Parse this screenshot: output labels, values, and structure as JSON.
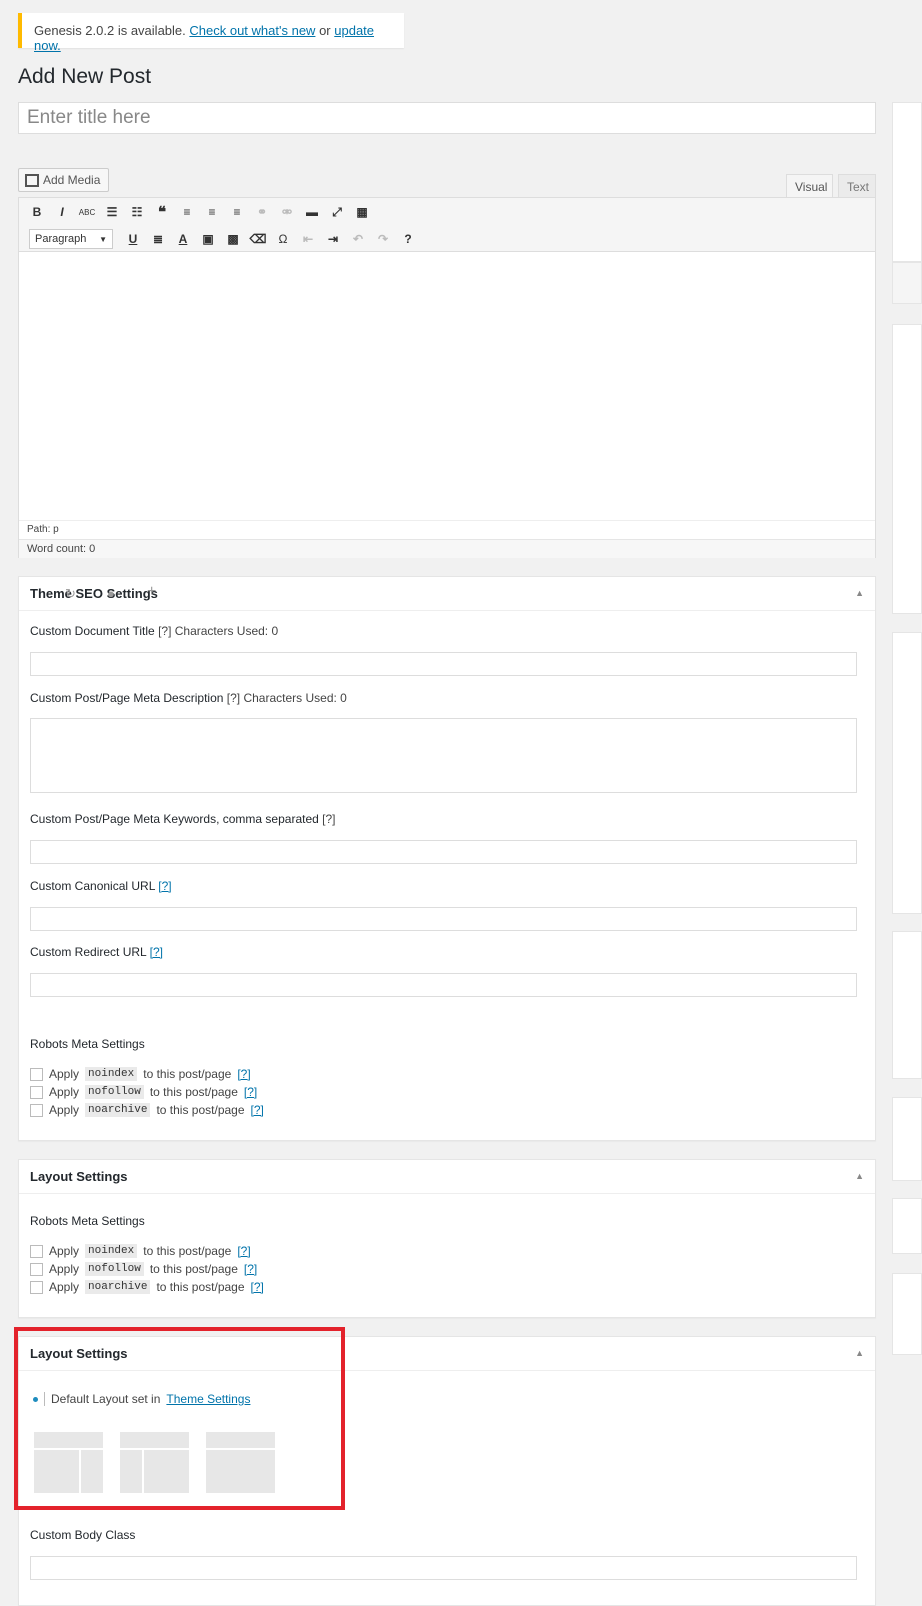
{
  "notice": {
    "text": "Genesis 2.0.2 is available.",
    "link1": "Check out what's new",
    "or": "or",
    "link2": "update now."
  },
  "page_title": "Add New Post",
  "title_input": {
    "placeholder": "Enter title here"
  },
  "editor": {
    "add_media": "Add Media",
    "tabs": {
      "visual": "Visual",
      "text": "Text"
    },
    "format_select": "Paragraph",
    "path": "Path: p",
    "word_count": "Word count: 0"
  },
  "seo_box": {
    "title": "Theme SEO Settings",
    "custom_doc_title": "Custom Document Title",
    "help": "[?]",
    "chars_used": "Characters Used: 0",
    "meta_desc": "Custom Post/Page Meta Description",
    "meta_keywords": "Custom Post/Page Meta Keywords, comma separated",
    "canonical": "Custom Canonical URL",
    "redirect": "Custom Redirect URL",
    "robots_heading": "Robots Meta Settings"
  },
  "robots": {
    "apply": "Apply",
    "suffix": "to this post/page",
    "help": "[?]",
    "items": [
      "noindex",
      "nofollow",
      "noarchive"
    ]
  },
  "layout_box_1": {
    "title": "Layout Settings",
    "robots_heading": "Robots Meta Settings"
  },
  "layout_box_2": {
    "title": "Layout Settings",
    "default_text": "Default Layout set in",
    "theme_settings_link": "Theme Settings",
    "custom_body_class": "Custom Body Class"
  },
  "colors": {
    "highlight": "#e3222b",
    "notice_border": "#ffba00",
    "link": "#0073aa"
  }
}
